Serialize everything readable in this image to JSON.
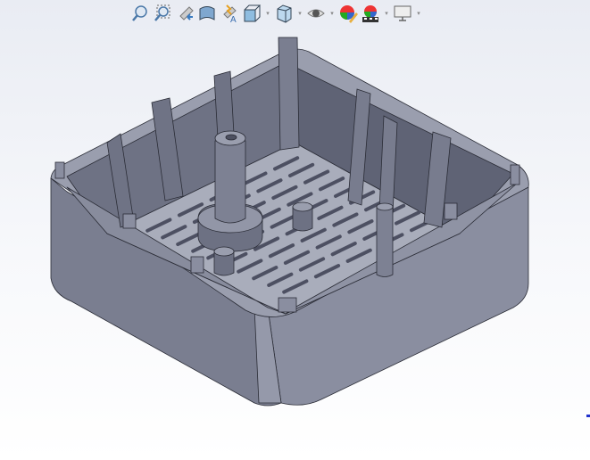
{
  "toolbar": {
    "items": [
      {
        "icon": "zoom-to-fit-icon"
      },
      {
        "icon": "zoom-to-area-icon"
      },
      {
        "icon": "previous-view-icon"
      },
      {
        "icon": "section-view-icon"
      },
      {
        "icon": "dynamic-annotation-views-icon"
      },
      {
        "icon": "view-orientation-icon",
        "dropdown": true
      },
      {
        "icon": "display-style-icon",
        "dropdown": true
      },
      {
        "icon": "hide-show-items-icon",
        "dropdown": true
      },
      {
        "icon": "edit-appearance-icon"
      },
      {
        "icon": "apply-scene-icon",
        "dropdown": true
      },
      {
        "icon": "view-settings-icon",
        "dropdown": true
      }
    ]
  },
  "colors": {
    "model": "#7c8092",
    "model_dark": "#5b5f70",
    "floor": "#a9adbb",
    "background": "#eef0f5"
  }
}
